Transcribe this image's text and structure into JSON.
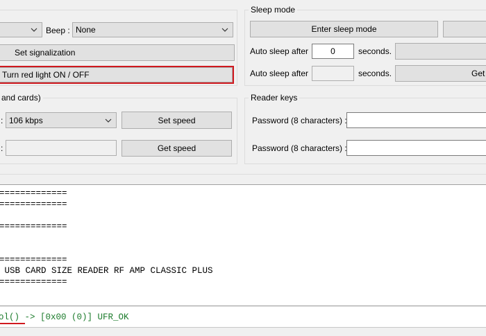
{
  "signal": {
    "beep_label": "Beep :",
    "beep_value": "None",
    "set_signal_label": "Set signalization",
    "red_light_label": "Turn red light ON / OFF"
  },
  "speed": {
    "group_title": "and cards)",
    "speed_value": "106 kbps",
    "set_speed_label": "Set speed",
    "get_speed_label": "Get speed",
    "colon": ":",
    "get_speed_field": ""
  },
  "sleep": {
    "group_title": "Sleep mode",
    "enter_sleep_label": "Enter sleep mode",
    "auto_sleep_label": "Auto sleep after",
    "auto_sleep_value": "0",
    "seconds_label": "seconds.",
    "get_label": "Get"
  },
  "reader_keys": {
    "group_title": "Reader keys",
    "password_label": "Password (8 characters) :"
  },
  "console": {
    "lines": [
      "=============",
      "=============",
      "",
      "",
      "=============",
      "",
      "",
      "",
      "=============",
      " USB CARD SIZE READER RF AMP CLASSIC PLUS",
      "============="
    ]
  },
  "status": {
    "text": "ol() -> [0x00 (0)] UFR_OK"
  },
  "colors": {
    "status_text": "#1a7a2a",
    "red_highlight": "#d0191f"
  }
}
